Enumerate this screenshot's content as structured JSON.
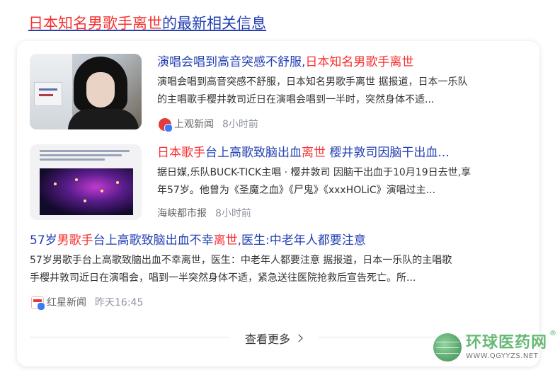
{
  "section_title": {
    "highlight": "日本知名男歌手离世",
    "rest": "的最新相关信息"
  },
  "items": [
    {
      "title_plain": "演唱会唱到高音突感不舒服,",
      "title_highlight": "日本知名男歌手离世",
      "snippet_line1": "演唱会唱到高音突感不舒服，日本知名男歌手离世 据报道，日本一乐队",
      "snippet_line2": "的主唱歌手樱井敦司近日在演唱会唱到一半时，突然身体不适...",
      "source": "上观新闻",
      "time": "8小时前",
      "source_icon": "shangguan-logo"
    },
    {
      "title_hl1": "日本歌手",
      "title_p1": "台上高歌致脑出血",
      "title_hl2": "离世",
      "title_p2": " 樱井敦司因脑干出血...",
      "snippet_line1": "据日媒,乐队BUCK-TICK主唱 · 樱井敦司 因脑干出血于10月19日去世,享",
      "snippet_line2": "年57岁。他曾为《圣魔之血》《尸鬼》《xxxHOLiC》演唱过主...",
      "source": "海峡都市报",
      "time": "8小时前"
    },
    {
      "title_p1": "57岁",
      "title_hl1": "男歌手",
      "title_p2": "台上高歌致脑出血不幸",
      "title_hl2": "离世",
      "title_p3": ",医生:中老年人都要注意",
      "snippet_line1": "57岁男歌手台上高歌致脑出血不幸离世，医生：中老年人都要注意 据报道，日本一乐队的主唱歌",
      "snippet_line2": "手樱井敦司近日在演唱会，唱到一半突然身体不适，紧急送往医院抢救后宣告死亡。所...",
      "source": "红星新闻",
      "time": "昨天16:45",
      "source_icon": "hongxing-logo"
    }
  ],
  "see_more": "查看更多",
  "watermark": {
    "cn": "环球医药网",
    "url": "WWW.QGYYZS.NET",
    "reg": "®"
  }
}
